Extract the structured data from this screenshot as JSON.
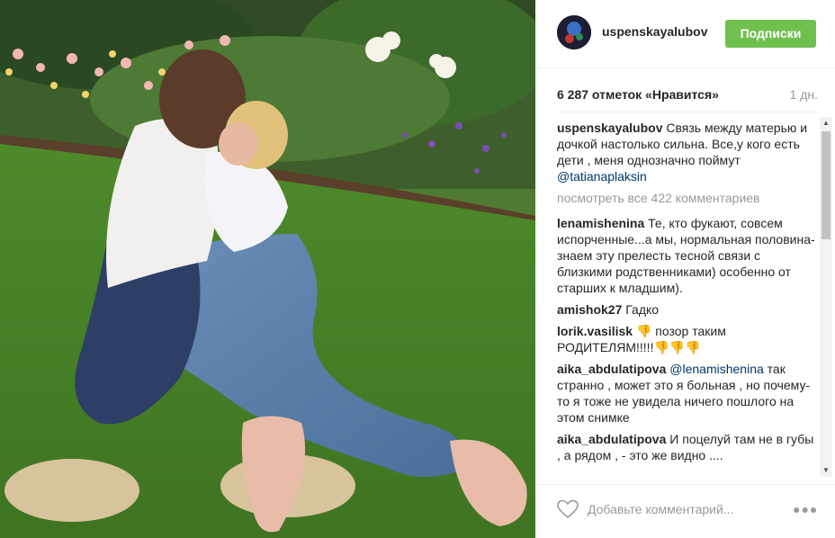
{
  "header": {
    "username": "uspenskayalubov",
    "follow_label": "Подписки",
    "follow_color": "#70c050"
  },
  "stats": {
    "likes": "6 287 отметок «Нравится»",
    "time": "1 дн."
  },
  "caption": {
    "user": "uspenskayalubov",
    "text": " Связь между матерью и дочкой настолько сильна. Все,у кого есть дети , меня однозначно поймут ",
    "mention": "@tatianaplaksin"
  },
  "view_all": "посмотреть все 422 комментариев",
  "comments": [
    {
      "user": "lenamishenina",
      "text": " Те, кто фукают, совсем испорченные...а мы, нормальная половина-знаем эту прелесть тесной связи с близкими родственниками) особенно от старших к младшим)."
    },
    {
      "user": "amishok27",
      "text": " Гадко"
    },
    {
      "user": "lorik.vasilisk",
      "text": " 👎 позор таким РОДИТЕЛЯМ!!!!!👎👎👎"
    },
    {
      "user": "aika_abdulatipova",
      "mention": " @lenamishenina",
      "text": " так странно , может это я больная , но почему- то я тоже не увидела ничего пошлого на этом снимке"
    },
    {
      "user": "aika_abdulatipova",
      "text": " И поцелуй там не в губы , а рядом , - это же видно ...."
    }
  ],
  "input": {
    "placeholder": "Добавьте комментарий..."
  },
  "icons": {
    "like": "heart-icon",
    "more": "more-options-icon"
  },
  "colors": {
    "mention": "#003569",
    "muted": "#999999"
  }
}
